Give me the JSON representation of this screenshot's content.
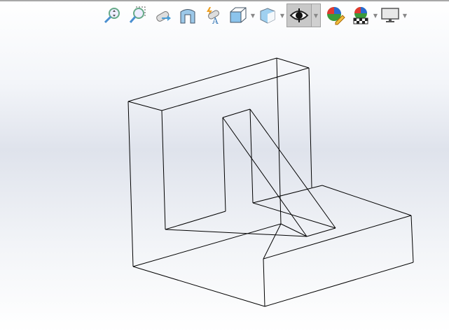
{
  "toolbar": {
    "tools": [
      {
        "icon": "zoom-to-fit-icon"
      },
      {
        "icon": "zoom-to-area-icon"
      },
      {
        "icon": "previous-view-icon"
      },
      {
        "icon": "section-view-icon"
      },
      {
        "icon": "dynamic-annotation-views-icon"
      },
      {
        "icon": "view-orientation-icon"
      },
      {
        "icon": "display-style-icon"
      },
      {
        "icon": "hide-show-items-icon",
        "active": true
      },
      {
        "icon": "edit-appearance-icon"
      },
      {
        "icon": "apply-scene-icon"
      },
      {
        "icon": "view-settings-icon"
      }
    ],
    "colors": {
      "active": "#c8c8c8",
      "accent": "#4a9fd8"
    }
  }
}
